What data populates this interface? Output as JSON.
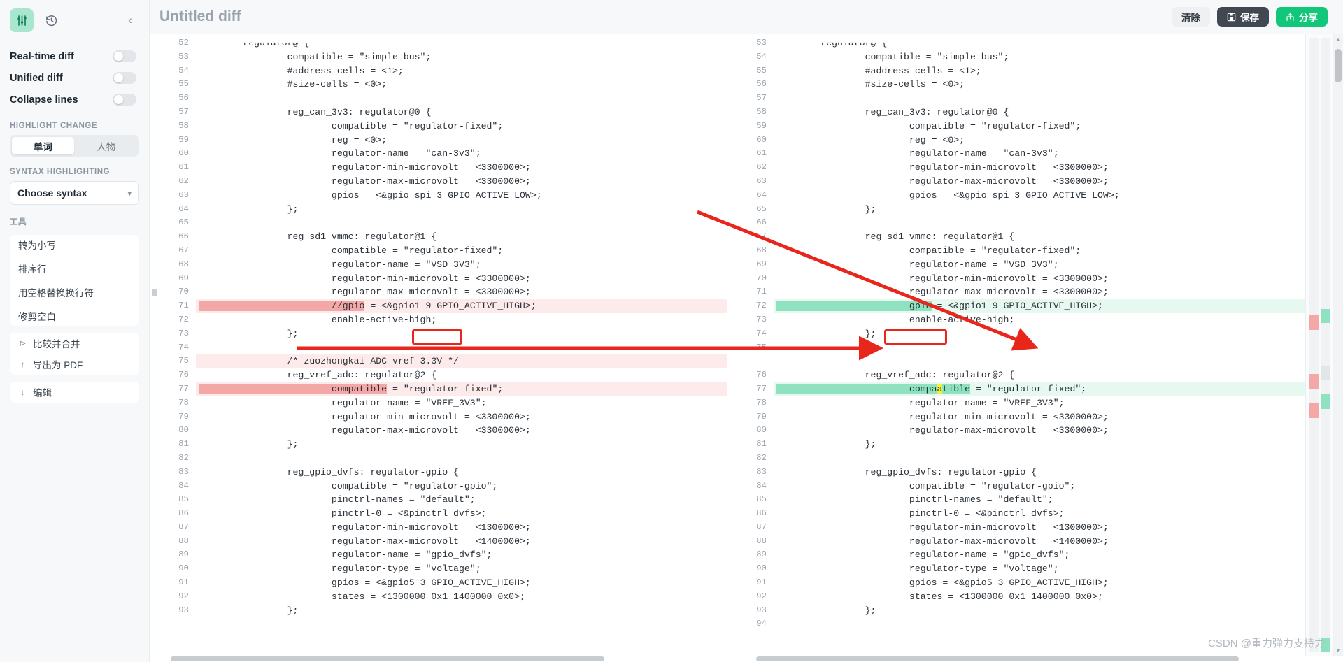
{
  "sidebar": {
    "logo_icon": "diff-sliders-icon",
    "history_icon": "history-clock-icon",
    "collapse_icon": "chevron-left-icon",
    "toggles": [
      {
        "label": "Real-time diff",
        "on": false
      },
      {
        "label": "Unified diff",
        "on": false
      },
      {
        "label": "Collapse lines",
        "on": false
      }
    ],
    "highlight_change": {
      "title": "HIGHLIGHT CHANGE",
      "options": [
        {
          "label": "单词",
          "active": true
        },
        {
          "label": "人物",
          "active": false
        }
      ]
    },
    "syntax": {
      "title": "SYNTAX HIGHLIGHTING",
      "value": "Choose syntax",
      "chevron_icon": "chevron-down-icon"
    },
    "tools": {
      "title": "工具",
      "items": [
        "转为小写",
        "排序行",
        "用空格替换换行符",
        "修剪空白"
      ]
    },
    "actions": [
      {
        "label": "比较并合并",
        "icon": "merge-arrows-icon"
      },
      {
        "label": "导出为 PDF",
        "icon": "download-arrow-icon"
      },
      {
        "label": "编辑",
        "icon": "download-arrow-icon"
      }
    ]
  },
  "header": {
    "title": "Untitled diff",
    "buttons": [
      {
        "label": "清除",
        "style": "clear",
        "icon": ""
      },
      {
        "label": "保存",
        "style": "save",
        "icon": "floppy-disk-icon"
      },
      {
        "label": "分享",
        "style": "share",
        "icon": "share-arrow-icon"
      }
    ]
  },
  "watermark": "CSDN @重力弹力支持力",
  "colors": {
    "accent_green": "#12c779",
    "delete_row": "#fdeaea",
    "delete_word": "#f4a7a7",
    "insert_row": "#e7f8f1",
    "insert_word": "#8fe2c0",
    "blank_row": "#ebedef",
    "annotation_red": "#e8261b",
    "word_highlight": "#f4ee3c"
  },
  "diff": {
    "left": [
      {
        "n": "52",
        "text": "\tregulator@ {",
        "type": "ctx",
        "cut": true
      },
      {
        "n": "53",
        "text": "\t\tcompatible = \"simple-bus\";",
        "type": "ctx"
      },
      {
        "n": "54",
        "text": "\t\t#address-cells = <1>;",
        "type": "ctx"
      },
      {
        "n": "55",
        "text": "\t\t#size-cells = <0>;",
        "type": "ctx"
      },
      {
        "n": "56",
        "text": "",
        "type": "ctx"
      },
      {
        "n": "57",
        "text": "\t\treg_can_3v3: regulator@0 {",
        "type": "ctx"
      },
      {
        "n": "58",
        "text": "\t\t\tcompatible = \"regulator-fixed\";",
        "type": "ctx"
      },
      {
        "n": "59",
        "text": "\t\t\treg = <0>;",
        "type": "ctx"
      },
      {
        "n": "60",
        "text": "\t\t\tregulator-name = \"can-3v3\";",
        "type": "ctx"
      },
      {
        "n": "61",
        "text": "\t\t\tregulator-min-microvolt = <3300000>;",
        "type": "ctx"
      },
      {
        "n": "62",
        "text": "\t\t\tregulator-max-microvolt = <3300000>;",
        "type": "ctx"
      },
      {
        "n": "63",
        "text": "\t\t\tgpios = <&gpio_spi 3 GPIO_ACTIVE_LOW>;",
        "type": "ctx"
      },
      {
        "n": "64",
        "text": "\t\t};",
        "type": "ctx"
      },
      {
        "n": "65",
        "text": "",
        "type": "ctx"
      },
      {
        "n": "66",
        "text": "\t\treg_sd1_vmmc: regulator@1 {",
        "type": "ctx"
      },
      {
        "n": "67",
        "text": "\t\t\tcompatible = \"regulator-fixed\";",
        "type": "ctx"
      },
      {
        "n": "68",
        "text": "\t\t\tregulator-name = \"VSD_3V3\";",
        "type": "ctx"
      },
      {
        "n": "69",
        "text": "\t\t\tregulator-min-microvolt = <3300000>;",
        "type": "ctx"
      },
      {
        "n": "70",
        "text": "\t\t\tregulator-max-microvolt = <3300000>;",
        "type": "ctx",
        "marker": true
      },
      {
        "n": "71",
        "pre": "\t\t\t",
        "word": "//gpio",
        "post": " = <&gpio1 9 GPIO_ACTIVE_HIGH>;",
        "type": "del"
      },
      {
        "n": "72",
        "text": "\t\t\tenable-active-high;",
        "type": "ctx"
      },
      {
        "n": "73",
        "text": "\t\t};",
        "type": "ctx"
      },
      {
        "n": "74",
        "text": "",
        "type": "ctx"
      },
      {
        "n": "75",
        "text": "\t\t/* zuozhongkai ADC vref 3.3V */",
        "type": "del-full"
      },
      {
        "n": "76",
        "text": "\t\treg_vref_adc: regulator@2 {",
        "type": "ctx"
      },
      {
        "n": "77",
        "pre": "\t\t\t",
        "word": "compatible",
        "post": " = \"regulator-fixed\";",
        "type": "del"
      },
      {
        "n": "78",
        "text": "\t\t\tregulator-name = \"VREF_3V3\";",
        "type": "ctx"
      },
      {
        "n": "79",
        "text": "\t\t\tregulator-min-microvolt = <3300000>;",
        "type": "ctx"
      },
      {
        "n": "80",
        "text": "\t\t\tregulator-max-microvolt = <3300000>;",
        "type": "ctx"
      },
      {
        "n": "81",
        "text": "\t\t};",
        "type": "ctx"
      },
      {
        "n": "82",
        "text": "",
        "type": "ctx"
      },
      {
        "n": "83",
        "text": "\t\treg_gpio_dvfs: regulator-gpio {",
        "type": "ctx"
      },
      {
        "n": "84",
        "text": "\t\t\tcompatible = \"regulator-gpio\";",
        "type": "ctx"
      },
      {
        "n": "85",
        "text": "\t\t\tpinctrl-names = \"default\";",
        "type": "ctx"
      },
      {
        "n": "86",
        "text": "\t\t\tpinctrl-0 = <&pinctrl_dvfs>;",
        "type": "ctx"
      },
      {
        "n": "87",
        "text": "\t\t\tregulator-min-microvolt = <1300000>;",
        "type": "ctx"
      },
      {
        "n": "88",
        "text": "\t\t\tregulator-max-microvolt = <1400000>;",
        "type": "ctx"
      },
      {
        "n": "89",
        "text": "\t\t\tregulator-name = \"gpio_dvfs\";",
        "type": "ctx"
      },
      {
        "n": "90",
        "text": "\t\t\tregulator-type = \"voltage\";",
        "type": "ctx"
      },
      {
        "n": "91",
        "text": "\t\t\tgpios = <&gpio5 3 GPIO_ACTIVE_HIGH>;",
        "type": "ctx"
      },
      {
        "n": "92",
        "text": "\t\t\tstates = <1300000 0x1 1400000 0x0>;",
        "type": "ctx"
      },
      {
        "n": "93",
        "text": "\t\t};",
        "type": "ctx"
      }
    ],
    "right": [
      {
        "n": "53",
        "text": "\tregulator@ {",
        "type": "ctx",
        "cut": true
      },
      {
        "n": "54",
        "text": "\t\tcompatible = \"simple-bus\";",
        "type": "ctx"
      },
      {
        "n": "55",
        "text": "\t\t#address-cells = <1>;",
        "type": "ctx"
      },
      {
        "n": "56",
        "text": "\t\t#size-cells = <0>;",
        "type": "ctx"
      },
      {
        "n": "57",
        "text": "",
        "type": "ctx"
      },
      {
        "n": "58",
        "text": "\t\treg_can_3v3: regulator@0 {",
        "type": "ctx"
      },
      {
        "n": "59",
        "text": "\t\t\tcompatible = \"regulator-fixed\";",
        "type": "ctx"
      },
      {
        "n": "60",
        "text": "\t\t\treg = <0>;",
        "type": "ctx"
      },
      {
        "n": "61",
        "text": "\t\t\tregulator-name = \"can-3v3\";",
        "type": "ctx"
      },
      {
        "n": "62",
        "text": "\t\t\tregulator-min-microvolt = <3300000>;",
        "type": "ctx"
      },
      {
        "n": "63",
        "text": "\t\t\tregulator-max-microvolt = <3300000>;",
        "type": "ctx"
      },
      {
        "n": "64",
        "text": "\t\t\tgpios = <&gpio_spi 3 GPIO_ACTIVE_LOW>;",
        "type": "ctx"
      },
      {
        "n": "65",
        "text": "\t\t};",
        "type": "ctx"
      },
      {
        "n": "66",
        "text": "",
        "type": "ctx"
      },
      {
        "n": "67",
        "text": "\t\treg_sd1_vmmc: regulator@1 {",
        "type": "ctx"
      },
      {
        "n": "68",
        "text": "\t\t\tcompatible = \"regulator-fixed\";",
        "type": "ctx"
      },
      {
        "n": "69",
        "text": "\t\t\tregulator-name = \"VSD_3V3\";",
        "type": "ctx"
      },
      {
        "n": "70",
        "text": "\t\t\tregulator-min-microvolt = <3300000>;",
        "type": "ctx"
      },
      {
        "n": "71",
        "text": "\t\t\tregulator-max-microvolt = <3300000>;",
        "type": "ctx"
      },
      {
        "n": "72",
        "pre": "\t\t\t",
        "word": "gpio",
        "post": " = <&gpio1 9 GPIO_ACTIVE_HIGH>;",
        "type": "ins"
      },
      {
        "n": "73",
        "text": "\t\t\tenable-active-high;",
        "type": "ctx"
      },
      {
        "n": "74",
        "text": "\t\t};",
        "type": "ctx"
      },
      {
        "n": "75",
        "text": "",
        "type": "ctx"
      },
      {
        "n": "",
        "text": "",
        "type": "blank"
      },
      {
        "n": "76",
        "text": "\t\treg_vref_adc: regulator@2 {",
        "type": "ctx"
      },
      {
        "n": "77",
        "pre": "\t\t\t",
        "word": "compaatible",
        "word_sub": "a",
        "post": " = \"regulator-fixed\";",
        "type": "ins"
      },
      {
        "n": "78",
        "text": "\t\t\tregulator-name = \"VREF_3V3\";",
        "type": "ctx"
      },
      {
        "n": "79",
        "text": "\t\t\tregulator-min-microvolt = <3300000>;",
        "type": "ctx"
      },
      {
        "n": "80",
        "text": "\t\t\tregulator-max-microvolt = <3300000>;",
        "type": "ctx"
      },
      {
        "n": "81",
        "text": "\t\t};",
        "type": "ctx"
      },
      {
        "n": "82",
        "text": "",
        "type": "ctx"
      },
      {
        "n": "83",
        "text": "\t\treg_gpio_dvfs: regulator-gpio {",
        "type": "ctx"
      },
      {
        "n": "84",
        "text": "\t\t\tcompatible = \"regulator-gpio\";",
        "type": "ctx"
      },
      {
        "n": "85",
        "text": "\t\t\tpinctrl-names = \"default\";",
        "type": "ctx"
      },
      {
        "n": "86",
        "text": "\t\t\tpinctrl-0 = <&pinctrl_dvfs>;",
        "type": "ctx"
      },
      {
        "n": "87",
        "text": "\t\t\tregulator-min-microvolt = <1300000>;",
        "type": "ctx"
      },
      {
        "n": "88",
        "text": "\t\t\tregulator-max-microvolt = <1400000>;",
        "type": "ctx"
      },
      {
        "n": "89",
        "text": "\t\t\tregulator-name = \"gpio_dvfs\";",
        "type": "ctx"
      },
      {
        "n": "90",
        "text": "\t\t\tregulator-type = \"voltage\";",
        "type": "ctx"
      },
      {
        "n": "91",
        "text": "\t\t\tgpios = <&gpio5 3 GPIO_ACTIVE_HIGH>;",
        "type": "ctx"
      },
      {
        "n": "92",
        "text": "\t\t\tstates = <1300000 0x1 1400000 0x0>;",
        "type": "ctx"
      },
      {
        "n": "93",
        "text": "\t\t};",
        "type": "ctx"
      },
      {
        "n": "94",
        "text": "",
        "type": "ins-empty"
      }
    ]
  }
}
